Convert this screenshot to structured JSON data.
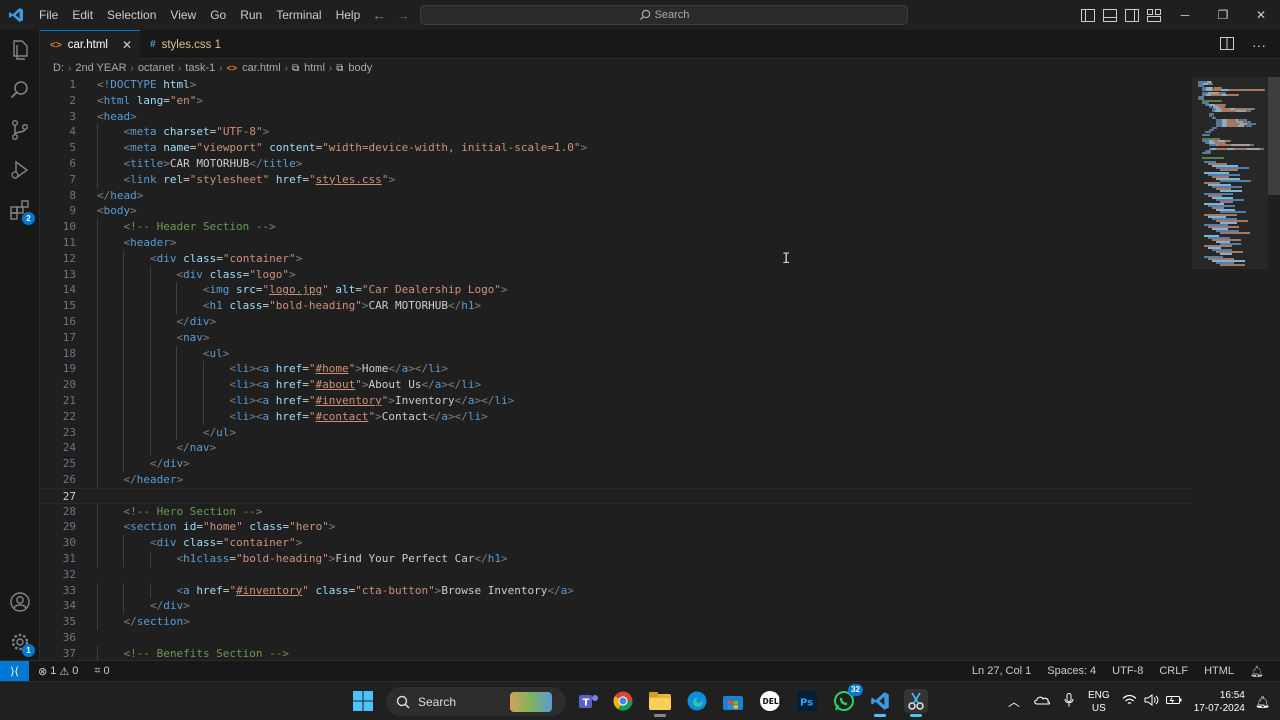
{
  "menu": [
    "File",
    "Edit",
    "Selection",
    "View",
    "Go",
    "Run",
    "Terminal",
    "Help"
  ],
  "command_center": {
    "placeholder": "Search"
  },
  "tabs": [
    {
      "label": "car.html",
      "icon": "html-file-icon",
      "active": true
    },
    {
      "label": "styles.css 1",
      "icon": "css-file-icon",
      "active": false
    }
  ],
  "breadcrumb": [
    "D:",
    "2nd YEAR",
    "octanet",
    "task-1",
    "car.html",
    "html",
    "body"
  ],
  "editor": {
    "current_line": 27,
    "lines": [
      {
        "n": "1",
        "indent": 0,
        "segs": [
          [
            "p",
            "<!"
          ],
          [
            "t",
            "DOCTYPE"
          ],
          [
            "p",
            " "
          ],
          [
            "a",
            "html"
          ],
          [
            "p",
            ">"
          ]
        ]
      },
      {
        "n": "2",
        "indent": 0,
        "segs": [
          [
            "p",
            "<"
          ],
          [
            "t",
            "html"
          ],
          [
            "x",
            " "
          ],
          [
            "a",
            "lang"
          ],
          [
            "x",
            "="
          ],
          [
            "s",
            "\"en\""
          ],
          [
            "p",
            ">"
          ]
        ]
      },
      {
        "n": "3",
        "indent": 0,
        "segs": [
          [
            "p",
            "<"
          ],
          [
            "t",
            "head"
          ],
          [
            "p",
            ">"
          ]
        ]
      },
      {
        "n": "4",
        "indent": 1,
        "segs": [
          [
            "p",
            "<"
          ],
          [
            "t",
            "meta"
          ],
          [
            "x",
            " "
          ],
          [
            "a",
            "charset"
          ],
          [
            "x",
            "="
          ],
          [
            "s",
            "\"UTF-8\""
          ],
          [
            "p",
            ">"
          ]
        ]
      },
      {
        "n": "5",
        "indent": 1,
        "segs": [
          [
            "p",
            "<"
          ],
          [
            "t",
            "meta"
          ],
          [
            "x",
            " "
          ],
          [
            "a",
            "name"
          ],
          [
            "x",
            "="
          ],
          [
            "s",
            "\"viewport\""
          ],
          [
            "x",
            " "
          ],
          [
            "a",
            "content"
          ],
          [
            "x",
            "="
          ],
          [
            "s",
            "\"width=device-width, initial-scale=1.0\""
          ],
          [
            "p",
            ">"
          ]
        ]
      },
      {
        "n": "6",
        "indent": 1,
        "segs": [
          [
            "p",
            "<"
          ],
          [
            "t",
            "title"
          ],
          [
            "p",
            ">"
          ],
          [
            "x",
            "CAR MOTORHUB"
          ],
          [
            "p",
            "</"
          ],
          [
            "t",
            "title"
          ],
          [
            "p",
            ">"
          ]
        ]
      },
      {
        "n": "7",
        "indent": 1,
        "segs": [
          [
            "p",
            "<"
          ],
          [
            "t",
            "link"
          ],
          [
            "x",
            " "
          ],
          [
            "a",
            "rel"
          ],
          [
            "x",
            "="
          ],
          [
            "s",
            "\"stylesheet\""
          ],
          [
            "x",
            " "
          ],
          [
            "a",
            "href"
          ],
          [
            "x",
            "="
          ],
          [
            "s",
            "\""
          ],
          [
            "su",
            "styles.css"
          ],
          [
            "s",
            "\""
          ],
          [
            "p",
            ">"
          ]
        ]
      },
      {
        "n": "8",
        "indent": 0,
        "segs": [
          [
            "p",
            "</"
          ],
          [
            "t",
            "head"
          ],
          [
            "p",
            ">"
          ]
        ]
      },
      {
        "n": "9",
        "indent": 0,
        "segs": [
          [
            "p",
            "<"
          ],
          [
            "t",
            "body"
          ],
          [
            "p",
            ">"
          ]
        ]
      },
      {
        "n": "10",
        "indent": 1,
        "segs": [
          [
            "c",
            "<!-- Header Section -->"
          ]
        ]
      },
      {
        "n": "11",
        "indent": 1,
        "segs": [
          [
            "p",
            "<"
          ],
          [
            "t",
            "header"
          ],
          [
            "p",
            ">"
          ]
        ]
      },
      {
        "n": "12",
        "indent": 2,
        "segs": [
          [
            "p",
            "<"
          ],
          [
            "t",
            "div"
          ],
          [
            "x",
            " "
          ],
          [
            "a",
            "class"
          ],
          [
            "x",
            "="
          ],
          [
            "s",
            "\"container\""
          ],
          [
            "p",
            ">"
          ]
        ]
      },
      {
        "n": "13",
        "indent": 3,
        "segs": [
          [
            "p",
            "<"
          ],
          [
            "t",
            "div"
          ],
          [
            "x",
            " "
          ],
          [
            "a",
            "class"
          ],
          [
            "x",
            "="
          ],
          [
            "s",
            "\"logo\""
          ],
          [
            "p",
            ">"
          ]
        ]
      },
      {
        "n": "14",
        "indent": 4,
        "segs": [
          [
            "p",
            "<"
          ],
          [
            "t",
            "img"
          ],
          [
            "x",
            " "
          ],
          [
            "a",
            "src"
          ],
          [
            "x",
            "="
          ],
          [
            "s",
            "\""
          ],
          [
            "su",
            "logo.jpg"
          ],
          [
            "s",
            "\""
          ],
          [
            "x",
            " "
          ],
          [
            "a",
            "alt"
          ],
          [
            "x",
            "="
          ],
          [
            "s",
            "\"Car Dealership Logo\""
          ],
          [
            "p",
            ">"
          ]
        ]
      },
      {
        "n": "15",
        "indent": 4,
        "segs": [
          [
            "p",
            "<"
          ],
          [
            "t",
            "h1"
          ],
          [
            "x",
            " "
          ],
          [
            "a",
            "class"
          ],
          [
            "x",
            "="
          ],
          [
            "s",
            "\"bold-heading\""
          ],
          [
            "p",
            ">"
          ],
          [
            "x",
            "CAR MOTORHUB"
          ],
          [
            "p",
            "</"
          ],
          [
            "t",
            "h1"
          ],
          [
            "p",
            ">"
          ]
        ]
      },
      {
        "n": "16",
        "indent": 3,
        "segs": [
          [
            "p",
            "</"
          ],
          [
            "t",
            "div"
          ],
          [
            "p",
            ">"
          ]
        ]
      },
      {
        "n": "17",
        "indent": 3,
        "segs": [
          [
            "p",
            "<"
          ],
          [
            "t",
            "nav"
          ],
          [
            "p",
            ">"
          ]
        ]
      },
      {
        "n": "18",
        "indent": 4,
        "segs": [
          [
            "p",
            "<"
          ],
          [
            "t",
            "ul"
          ],
          [
            "p",
            ">"
          ]
        ]
      },
      {
        "n": "19",
        "indent": 5,
        "segs": [
          [
            "p",
            "<"
          ],
          [
            "t",
            "li"
          ],
          [
            "p",
            "><"
          ],
          [
            "t",
            "a"
          ],
          [
            "x",
            " "
          ],
          [
            "a",
            "href"
          ],
          [
            "x",
            "="
          ],
          [
            "s",
            "\""
          ],
          [
            "su",
            "#home"
          ],
          [
            "s",
            "\""
          ],
          [
            "p",
            ">"
          ],
          [
            "x",
            "Home"
          ],
          [
            "p",
            "</"
          ],
          [
            "t",
            "a"
          ],
          [
            "p",
            "></"
          ],
          [
            "t",
            "li"
          ],
          [
            "p",
            ">"
          ]
        ]
      },
      {
        "n": "20",
        "indent": 5,
        "segs": [
          [
            "p",
            "<"
          ],
          [
            "t",
            "li"
          ],
          [
            "p",
            "><"
          ],
          [
            "t",
            "a"
          ],
          [
            "x",
            " "
          ],
          [
            "a",
            "href"
          ],
          [
            "x",
            "="
          ],
          [
            "s",
            "\""
          ],
          [
            "su",
            "#about"
          ],
          [
            "s",
            "\""
          ],
          [
            "p",
            ">"
          ],
          [
            "x",
            "About Us"
          ],
          [
            "p",
            "</"
          ],
          [
            "t",
            "a"
          ],
          [
            "p",
            "></"
          ],
          [
            "t",
            "li"
          ],
          [
            "p",
            ">"
          ]
        ]
      },
      {
        "n": "21",
        "indent": 5,
        "segs": [
          [
            "p",
            "<"
          ],
          [
            "t",
            "li"
          ],
          [
            "p",
            "><"
          ],
          [
            "t",
            "a"
          ],
          [
            "x",
            " "
          ],
          [
            "a",
            "href"
          ],
          [
            "x",
            "="
          ],
          [
            "s",
            "\""
          ],
          [
            "su",
            "#inventory"
          ],
          [
            "s",
            "\""
          ],
          [
            "p",
            ">"
          ],
          [
            "x",
            "Inventory"
          ],
          [
            "p",
            "</"
          ],
          [
            "t",
            "a"
          ],
          [
            "p",
            "></"
          ],
          [
            "t",
            "li"
          ],
          [
            "p",
            ">"
          ]
        ]
      },
      {
        "n": "22",
        "indent": 5,
        "segs": [
          [
            "p",
            "<"
          ],
          [
            "t",
            "li"
          ],
          [
            "p",
            "><"
          ],
          [
            "t",
            "a"
          ],
          [
            "x",
            " "
          ],
          [
            "a",
            "href"
          ],
          [
            "x",
            "="
          ],
          [
            "s",
            "\""
          ],
          [
            "su",
            "#contact"
          ],
          [
            "s",
            "\""
          ],
          [
            "p",
            ">"
          ],
          [
            "x",
            "Contact"
          ],
          [
            "p",
            "</"
          ],
          [
            "t",
            "a"
          ],
          [
            "p",
            "></"
          ],
          [
            "t",
            "li"
          ],
          [
            "p",
            ">"
          ]
        ]
      },
      {
        "n": "23",
        "indent": 4,
        "segs": [
          [
            "p",
            "</"
          ],
          [
            "t",
            "ul"
          ],
          [
            "p",
            ">"
          ]
        ]
      },
      {
        "n": "24",
        "indent": 3,
        "segs": [
          [
            "p",
            "</"
          ],
          [
            "t",
            "nav"
          ],
          [
            "p",
            ">"
          ]
        ]
      },
      {
        "n": "25",
        "indent": 2,
        "segs": [
          [
            "p",
            "</"
          ],
          [
            "t",
            "div"
          ],
          [
            "p",
            ">"
          ]
        ]
      },
      {
        "n": "26",
        "indent": 1,
        "segs": [
          [
            "p",
            "</"
          ],
          [
            "t",
            "header"
          ],
          [
            "p",
            ">"
          ]
        ]
      },
      {
        "n": "27",
        "indent": 0,
        "segs": []
      },
      {
        "n": "28",
        "indent": 1,
        "segs": [
          [
            "c",
            "<!-- Hero Section -->"
          ]
        ]
      },
      {
        "n": "29",
        "indent": 1,
        "segs": [
          [
            "p",
            "<"
          ],
          [
            "t",
            "section"
          ],
          [
            "x",
            " "
          ],
          [
            "a",
            "id"
          ],
          [
            "x",
            "="
          ],
          [
            "s",
            "\"home\""
          ],
          [
            "x",
            " "
          ],
          [
            "a",
            "class"
          ],
          [
            "x",
            "="
          ],
          [
            "s",
            "\"hero\""
          ],
          [
            "p",
            ">"
          ]
        ]
      },
      {
        "n": "30",
        "indent": 2,
        "segs": [
          [
            "p",
            "<"
          ],
          [
            "t",
            "div"
          ],
          [
            "x",
            " "
          ],
          [
            "a",
            "class"
          ],
          [
            "x",
            "="
          ],
          [
            "s",
            "\"container\""
          ],
          [
            "p",
            ">"
          ]
        ]
      },
      {
        "n": "31",
        "indent": 3,
        "segs": [
          [
            "p",
            "<"
          ],
          [
            "t",
            "h1class"
          ],
          [
            "x",
            "="
          ],
          [
            "s",
            "\"bold-heading\""
          ],
          [
            "p",
            ">"
          ],
          [
            "x",
            "Find Your Perfect Car"
          ],
          [
            "p",
            "</"
          ],
          [
            "t",
            "h1"
          ],
          [
            "p",
            ">"
          ]
        ]
      },
      {
        "n": "32",
        "indent": 0,
        "segs": []
      },
      {
        "n": "33",
        "indent": 3,
        "segs": [
          [
            "p",
            "<"
          ],
          [
            "t",
            "a"
          ],
          [
            "x",
            " "
          ],
          [
            "a",
            "href"
          ],
          [
            "x",
            "="
          ],
          [
            "s",
            "\""
          ],
          [
            "su",
            "#inventory"
          ],
          [
            "s",
            "\""
          ],
          [
            "x",
            " "
          ],
          [
            "a",
            "class"
          ],
          [
            "x",
            "="
          ],
          [
            "s",
            "\"cta-button\""
          ],
          [
            "p",
            ">"
          ],
          [
            "x",
            "Browse Inventory"
          ],
          [
            "p",
            "</"
          ],
          [
            "t",
            "a"
          ],
          [
            "p",
            ">"
          ]
        ]
      },
      {
        "n": "34",
        "indent": 2,
        "segs": [
          [
            "p",
            "</"
          ],
          [
            "t",
            "div"
          ],
          [
            "p",
            ">"
          ]
        ]
      },
      {
        "n": "35",
        "indent": 1,
        "segs": [
          [
            "p",
            "</"
          ],
          [
            "t",
            "section"
          ],
          [
            "p",
            ">"
          ]
        ]
      },
      {
        "n": "36",
        "indent": 0,
        "segs": []
      },
      {
        "n": "37",
        "indent": 1,
        "segs": [
          [
            "c",
            "<!-- Benefits Section -->"
          ]
        ]
      }
    ]
  },
  "status": {
    "errors": "1",
    "warnings": "0",
    "ports": "0",
    "cursor": "Ln 27, Col 1",
    "spaces": "Spaces: 4",
    "encoding": "UTF-8",
    "eol": "CRLF",
    "language": "HTML"
  },
  "activity_badges": {
    "extensions": "2",
    "settings": "1"
  },
  "taskbar": {
    "search_label": "Search",
    "whatsapp_badge": "32",
    "lang_top": "ENG",
    "lang_bottom": "US",
    "time": "16:54",
    "date": "17-07-2024"
  },
  "colors": {
    "accent": "#0078d4",
    "tag": "#569cd6",
    "attr": "#9cdcfe",
    "string": "#ce9178",
    "comment": "#6a9955"
  }
}
